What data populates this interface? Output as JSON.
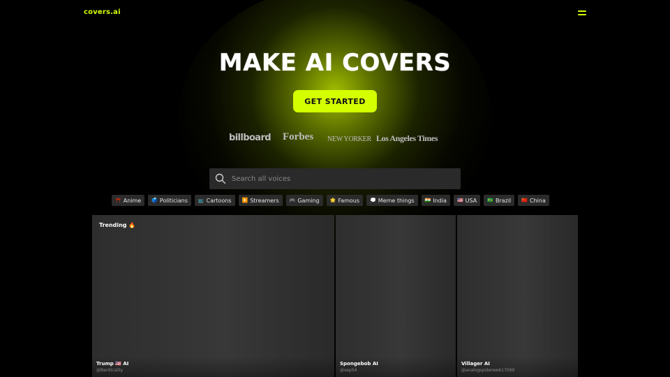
{
  "header": {
    "logo": "covers.ai",
    "menu_icon": "hamburger-menu-icon",
    "accent": "#d4ff00"
  },
  "hero": {
    "title": "MAKE AI COVERS",
    "cta_label": "GET STARTED"
  },
  "press": {
    "billboard": "billboard",
    "forbes": "Forbes",
    "newyorker": "NEW YORKER",
    "latimes": "Los Angeles Times"
  },
  "search": {
    "placeholder": "Search all voices",
    "icon": "search-icon"
  },
  "categories": [
    {
      "emoji": "⛩️",
      "label": "Anime"
    },
    {
      "emoji": "🗳️",
      "label": "Politicians"
    },
    {
      "emoji": "📺",
      "label": "Cartoons"
    },
    {
      "emoji": "▶️",
      "label": "Streamers"
    },
    {
      "emoji": "🎮",
      "label": "Gaming"
    },
    {
      "emoji": "🌟",
      "label": "Famous"
    },
    {
      "emoji": "💭",
      "label": "Meme things"
    },
    {
      "emoji": "🇮🇳",
      "label": "India"
    },
    {
      "emoji": "🇺🇸",
      "label": "USA"
    },
    {
      "emoji": "🇧🇷",
      "label": "Brazil"
    },
    {
      "emoji": "🇨🇳",
      "label": "China"
    }
  ],
  "trending_label": "Trending 🔥",
  "cards": [
    {
      "name": "Trump 🇺🇸 AI",
      "handle": "@Nerdicality"
    },
    {
      "name": "Spongebob AI",
      "handle": "@sep54"
    },
    {
      "name": "Villager AI",
      "handle": "@analogspiderweb17099"
    }
  ]
}
